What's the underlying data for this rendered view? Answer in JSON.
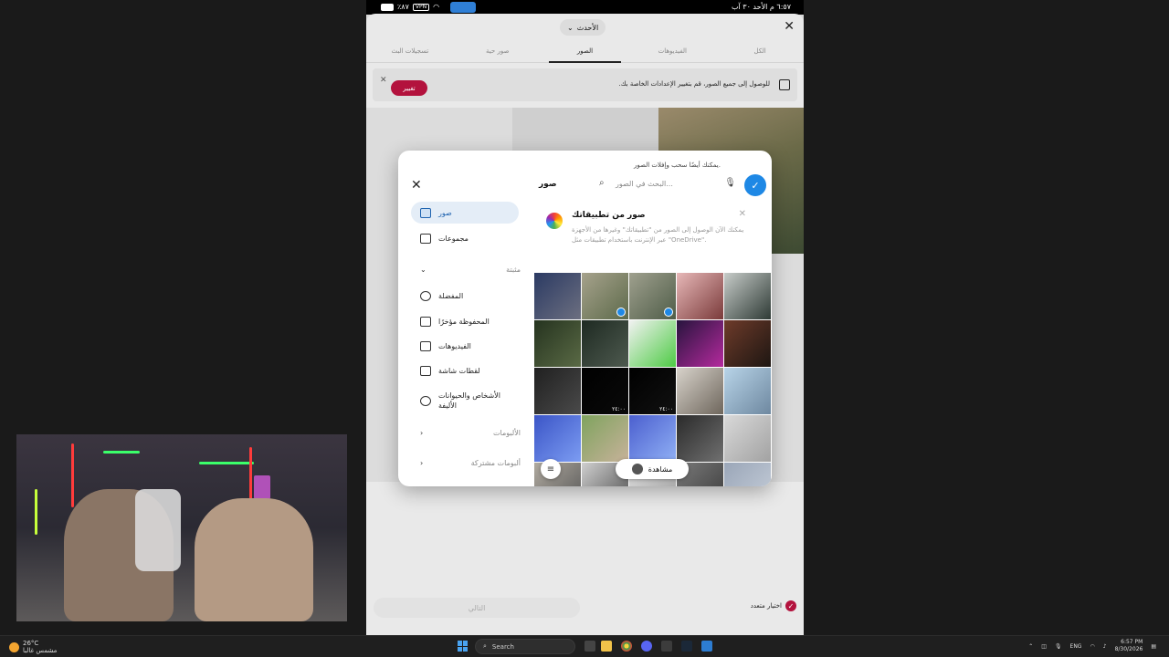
{
  "status_bar": {
    "time": "٦:٥٧ م  الأحد ٣٠ آب",
    "battery": "٪٨٧",
    "vpn": "VPN"
  },
  "sheet": {
    "dropdown_label": "الأحدث",
    "tabs": [
      "الكل",
      "الفيديوهات",
      "الصور",
      "صور حية",
      "تسجيلات البث"
    ],
    "active_tab": "الصور",
    "banner_text": "للوصول إلى جميع الصور، قم بتغيير الإعدادات الخاصة بك.",
    "banner_button": "تغيير",
    "next_button": "التالي",
    "multi_select": "اختيار متعدد"
  },
  "dialog": {
    "hint": "يمكنك أيضًا سحب وإفلات الصور.",
    "title": "صور",
    "search_placeholder": "البحث في الصور...",
    "sidebar": {
      "items": [
        {
          "label": "صور",
          "icon": "photos-icon",
          "active": true
        },
        {
          "label": "مجموعات",
          "icon": "collections-icon",
          "active": false
        }
      ],
      "section_pinned": "مثبتة",
      "pinned": [
        {
          "label": "المفضلة",
          "icon": "heart-icon"
        },
        {
          "label": "المحفوظة مؤخرًا",
          "icon": "recent-icon"
        },
        {
          "label": "الفيديوهات",
          "icon": "video-icon"
        },
        {
          "label": "لقطات شاشة",
          "icon": "screenshot-icon"
        },
        {
          "label": "الأشخاص والحيوانات الأليفة",
          "icon": "person-icon"
        }
      ],
      "section_albums": "الألبومات",
      "section_shared": "ألبومات مشتركة"
    },
    "promo": {
      "title": "صور من تطبيقاتك",
      "body": "يمكنك الآن الوصول إلى الصور من \"تطبيقاتك\" وغيرها من الأجهزة عبر الإنترنت باستخدام تطبيقات مثل \"OneDrive\"."
    },
    "sort_label": "ترتيب",
    "recent_pill": "مشاهدة"
  },
  "thumbs": [
    {
      "c1": "#2b3a63",
      "c2": "#6c6f80"
    },
    {
      "c1": "#a6a28c",
      "c2": "#5d6a4a",
      "selected": true
    },
    {
      "c1": "#9fa08e",
      "c2": "#4f5d48",
      "selected": true
    },
    {
      "c1": "#e7b8b8",
      "c2": "#7a3a3a"
    },
    {
      "c1": "#c7ccc9",
      "c2": "#2e3a35"
    },
    {
      "c1": "#25331f",
      "c2": "#5a6a45"
    },
    {
      "c1": "#1e2a22",
      "c2": "#4e5a4f"
    },
    {
      "c1": "#f2f2f2",
      "c2": "#4ecb45"
    },
    {
      "c1": "#27143d",
      "c2": "#b52a9e"
    },
    {
      "c1": "#6e3b2a",
      "c2": "#1d1612"
    },
    {
      "c1": "#202020",
      "c2": "#4a4a4a"
    },
    {
      "c1": "#000000",
      "c2": "#0a0a0a",
      "duration": "٢٤:٠٠"
    },
    {
      "c1": "#000000",
      "c2": "#111111",
      "duration": "٢٤:٠٠"
    },
    {
      "c1": "#d8d3cb",
      "c2": "#6e665c"
    },
    {
      "c1": "#b8d4e8",
      "c2": "#6e88a0"
    },
    {
      "c1": "#3b55c7",
      "c2": "#7c9cf2"
    },
    {
      "c1": "#7fa35e",
      "c2": "#c7b29a"
    },
    {
      "c1": "#4b5fcf",
      "c2": "#90b0f5"
    },
    {
      "c1": "#2a2a2a",
      "c2": "#707070"
    },
    {
      "c1": "#d9d9d9",
      "c2": "#a2a2a2"
    },
    {
      "c1": "#b0aaa0",
      "c2": "#555"
    },
    {
      "c1": "#cfcfcf",
      "c2": "#4c4c4c"
    },
    {
      "c1": "#e0e0e0",
      "c2": "#9a9a9a"
    },
    {
      "c1": "#7a7a7a",
      "c2": "#3a3a3a"
    },
    {
      "c1": "#9aa6b8",
      "c2": "#c7cfda"
    }
  ],
  "taskbar": {
    "weather_temp": "26°C",
    "weather_desc": "مشمس غالبا",
    "search_label": "Search",
    "lang": "ENG",
    "time": "6:57 PM",
    "date": "8/30/2026"
  },
  "colors": {
    "accent": "#b3123d",
    "blue": "#1e88e5"
  }
}
